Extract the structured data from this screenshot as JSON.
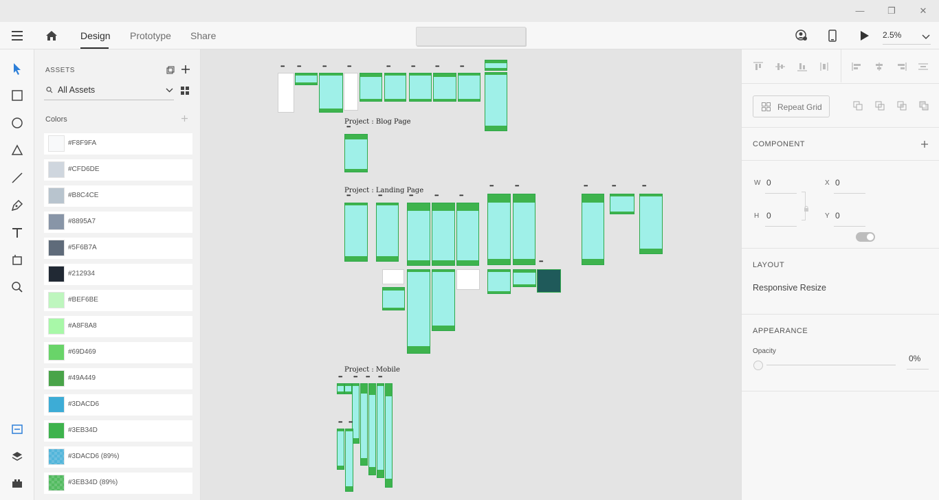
{
  "window": {
    "minimize": "—",
    "restore": "❐",
    "close": "✕"
  },
  "appbar": {
    "tabs": [
      {
        "label": "Design"
      },
      {
        "label": "Prototype"
      },
      {
        "label": "Share"
      }
    ],
    "zoom": "2.5%"
  },
  "assets": {
    "title": "ASSETS",
    "filter": "All Assets",
    "colors_label": "Colors",
    "colors": [
      {
        "label": "#F8F9FA",
        "hex": "#F8F9FA"
      },
      {
        "label": "#CFD6DE",
        "hex": "#CFD6DE"
      },
      {
        "label": "#B8C4CE",
        "hex": "#B8C4CE"
      },
      {
        "label": "#8895A7",
        "hex": "#8895A7"
      },
      {
        "label": "#5F6B7A",
        "hex": "#5F6B7A"
      },
      {
        "label": "#212934",
        "hex": "#212934"
      },
      {
        "label": "#BEF6BE",
        "hex": "#BEF6BE"
      },
      {
        "label": "#A8F8A8",
        "hex": "#A8F8A8"
      },
      {
        "label": "#69D469",
        "hex": "#69D469"
      },
      {
        "label": "#49A449",
        "hex": "#49A449"
      },
      {
        "label": "#3DACD6",
        "hex": "#3DACD6"
      },
      {
        "label": "#3EB34D",
        "hex": "#3EB34D"
      },
      {
        "label": "#3DACD6 (89%)",
        "hex": "#3DACD6"
      },
      {
        "label": "#3EB34D (89%)",
        "hex": "#3EB34D"
      }
    ]
  },
  "canvas": {
    "labels": {
      "blog": "Project : Blog Page",
      "landing": "Project : Landing Page",
      "mobile": "Project : Mobile"
    },
    "dots": "•••"
  },
  "props": {
    "repeat_grid": "Repeat Grid",
    "component": "COMPONENT",
    "w_label": "W",
    "w_value": "0",
    "h_label": "H",
    "h_value": "0",
    "x_label": "X",
    "x_value": "0",
    "y_label": "Y",
    "y_value": "0",
    "layout": "LAYOUT",
    "responsive_resize": "Responsive Resize",
    "appearance": "APPEARANCE",
    "opacity_label": "Opacity",
    "opacity_value": "0%"
  }
}
